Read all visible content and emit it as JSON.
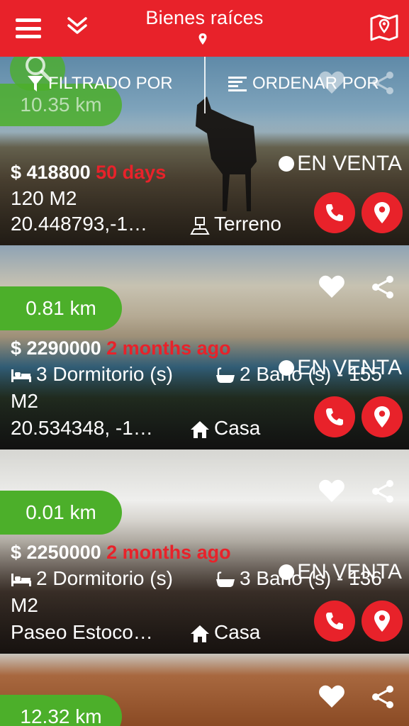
{
  "header": {
    "title": "Bienes raíces"
  },
  "toolbar": {
    "filter_label": "FILTRADO POR",
    "order_label": "ORDENAR POR"
  },
  "colors": {
    "primary": "#e8222a",
    "distance_badge": "#4caf2a"
  },
  "listings": [
    {
      "distance": "10.35 km",
      "price": "$ 418800",
      "age": "50 days",
      "status": "EN VENTA",
      "details": "120 M2",
      "coords": "20.448793,-1…",
      "type": "Terreno",
      "type_icon": "land-icon"
    },
    {
      "distance": "0.81 km",
      "price": "$ 2290000",
      "age": "2 months ago",
      "status": "EN VENTA",
      "bedrooms": "3 Dormitorio (s)",
      "bathrooms": "2 Baño (s) - 155",
      "details": "M2",
      "coords": "20.534348, -1…",
      "type": "Casa",
      "type_icon": "house-icon"
    },
    {
      "distance": "0.01 km",
      "price": "$ 2250000",
      "age": "2 months ago",
      "status": "EN VENTA",
      "bedrooms": "2 Dormitorio (s)",
      "bathrooms": "3 Baño (s) - 136",
      "details": "M2",
      "coords": "Paseo Estoco…",
      "type": "Casa",
      "type_icon": "house-icon"
    },
    {
      "distance": "12.32 km"
    }
  ]
}
